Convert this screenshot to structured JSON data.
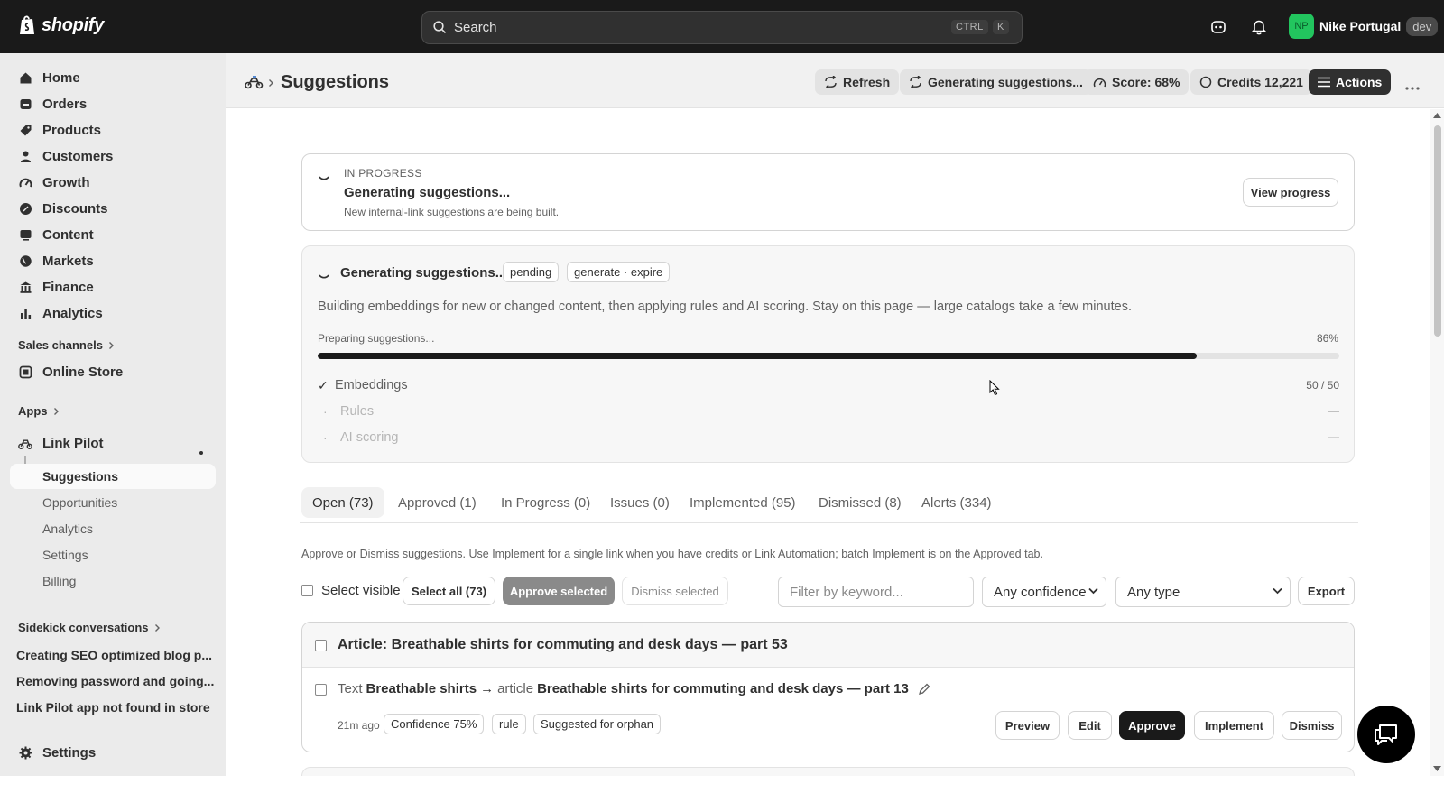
{
  "topbar": {
    "logo": "shopify",
    "search_placeholder": "Search",
    "kbd_ctrl": "CTRL",
    "kbd_k": "K",
    "store_initials": "NP",
    "store_name": "Nike Portugal",
    "env_badge": "dev",
    "colors": {
      "bar": "#1a1a1a",
      "avatar": "#22c55e"
    }
  },
  "sidebar": {
    "items": [
      {
        "label": "Home",
        "icon": "home-icon"
      },
      {
        "label": "Orders",
        "icon": "orders-icon"
      },
      {
        "label": "Products",
        "icon": "tag-icon"
      },
      {
        "label": "Customers",
        "icon": "person-icon"
      },
      {
        "label": "Growth",
        "icon": "gauge-icon"
      },
      {
        "label": "Discounts",
        "icon": "discount-icon"
      },
      {
        "label": "Content",
        "icon": "content-icon"
      },
      {
        "label": "Markets",
        "icon": "globe-icon"
      },
      {
        "label": "Finance",
        "icon": "bank-icon"
      },
      {
        "label": "Analytics",
        "icon": "bar-chart-icon"
      }
    ],
    "sales_channels_label": "Sales channels",
    "online_store_label": "Online Store",
    "apps_label": "Apps",
    "app_name": "Link Pilot",
    "app_subitems": [
      "Suggestions",
      "Opportunities",
      "Analytics",
      "Settings",
      "Billing"
    ],
    "sidekick_label": "Sidekick conversations",
    "conversations": [
      "Creating SEO optimized blog p...",
      "Removing password and going...",
      "Link Pilot app not found in store"
    ],
    "settings_label": "Settings"
  },
  "header": {
    "title": "Suggestions",
    "buttons": {
      "refresh": "Refresh",
      "generating": "Generating suggestions...",
      "score": "Score: 68%",
      "credits": "Credits 12,221",
      "actions": "Actions"
    }
  },
  "banner": {
    "status": "IN PROGRESS",
    "title": "Generating suggestions...",
    "description": "New internal-link suggestions are being built.",
    "button": "View progress"
  },
  "progress_card": {
    "title": "Generating suggestions...",
    "badge_pending": "pending",
    "badge_job": "generate · expire",
    "description": "Building embeddings for new or changed content, then applying rules and AI scoring. Stay on this page — large catalogs take a few minutes.",
    "progress_label": "Preparing suggestions...",
    "progress_percent_text": "86%",
    "progress_value": 86,
    "steps": [
      {
        "mark": "✓",
        "label": "Embeddings",
        "value": "50 / 50"
      },
      {
        "mark": "·",
        "label": "Rules",
        "value": "—"
      },
      {
        "mark": "·",
        "label": "AI scoring",
        "value": "—"
      }
    ]
  },
  "tabs": [
    "Open (73)",
    "Approved (1)",
    "In Progress (0)",
    "Issues (0)",
    "Implemented (95)",
    "Dismissed (8)",
    "Alerts (334)"
  ],
  "help_text": "Approve or Dismiss suggestions. Use Implement for a single link when you have credits or Link Automation; batch Implement is on the Approved tab.",
  "toolbar": {
    "select_visible": "Select visible",
    "select_all": "Select all (73)",
    "approve_selected": "Approve selected",
    "dismiss_selected": "Dismiss selected",
    "filter_placeholder": "Filter by keyword...",
    "confidence": "Any confidence",
    "type": "Any type",
    "export": "Export"
  },
  "group": {
    "title": "Article: Breathable shirts for commuting and desk days — part 53",
    "suggestion": {
      "prefix": "Text",
      "anchor": "Breathable shirts",
      "arrow": "→",
      "target_type": "article",
      "target": "Breathable shirts for commuting and desk days — part 13",
      "time": "21m ago",
      "confidence": "Confidence 75%",
      "source": "rule",
      "reason": "Suggested for orphan",
      "actions": {
        "preview": "Preview",
        "edit": "Edit",
        "approve": "Approve",
        "implement": "Implement",
        "dismiss": "Dismiss"
      }
    }
  }
}
